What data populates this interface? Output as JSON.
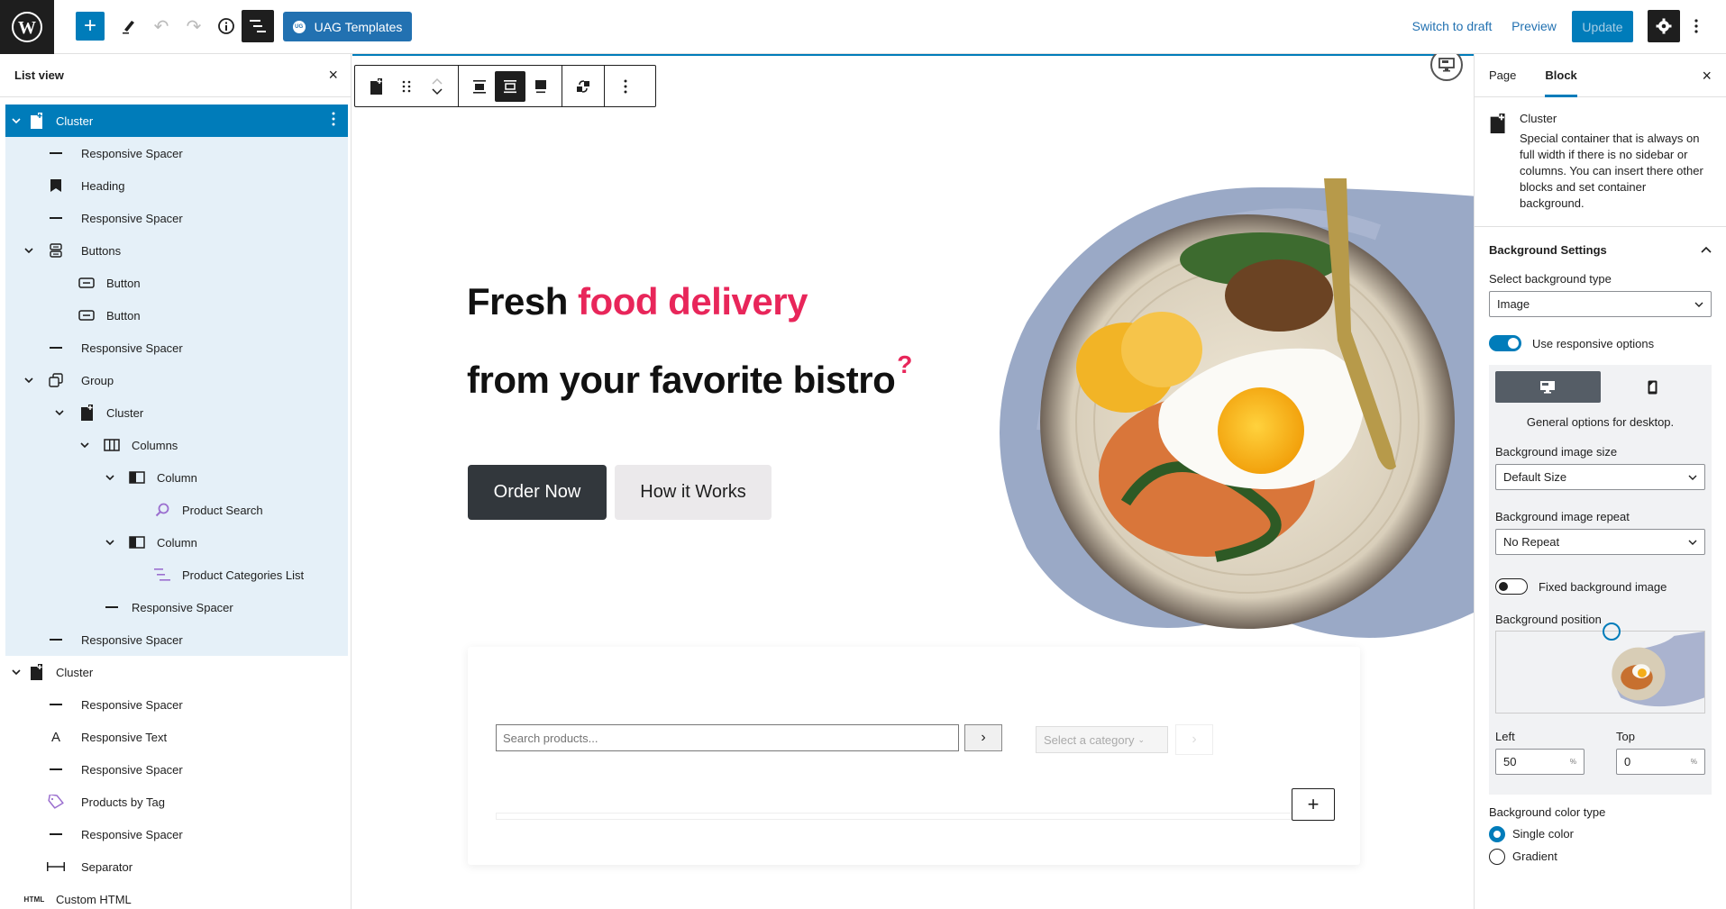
{
  "topbar": {
    "wp_logo": "wordpress-logo",
    "inserter_label": "+",
    "uag_badge": "UG",
    "uag_label": "UAG Templates",
    "switch_to_draft": "Switch to draft",
    "preview": "Preview",
    "update": "Update"
  },
  "listview": {
    "title": "List view",
    "close": "×",
    "items": [
      {
        "label": "Cluster",
        "icon": "cluster-icon",
        "depth": 0,
        "expanded": true,
        "selected": true
      },
      {
        "label": "Responsive Spacer",
        "icon": "spacer-icon",
        "depth": 1
      },
      {
        "label": "Heading",
        "icon": "heading-bookmark-icon",
        "depth": 1
      },
      {
        "label": "Responsive Spacer",
        "icon": "spacer-icon",
        "depth": 1
      },
      {
        "label": "Buttons",
        "icon": "buttons-icon",
        "depth": 1,
        "expanded": true
      },
      {
        "label": "Button",
        "icon": "button-icon",
        "depth": 2
      },
      {
        "label": "Button",
        "icon": "button-icon",
        "depth": 2
      },
      {
        "label": "Responsive Spacer",
        "icon": "spacer-icon",
        "depth": 1
      },
      {
        "label": "Group",
        "icon": "group-icon",
        "depth": 1,
        "expanded": true
      },
      {
        "label": "Cluster",
        "icon": "cluster-icon",
        "depth": 2,
        "expanded": true
      },
      {
        "label": "Columns",
        "icon": "columns-icon",
        "depth": 3,
        "expanded": true
      },
      {
        "label": "Column",
        "icon": "column-icon",
        "depth": 4,
        "expanded": true
      },
      {
        "label": "Product Search",
        "icon": "product-search-icon",
        "depth": 5
      },
      {
        "label": "Column",
        "icon": "column-icon",
        "depth": 4,
        "expanded": true
      },
      {
        "label": "Product Categories List",
        "icon": "product-categories-icon",
        "depth": 5
      },
      {
        "label": "Responsive Spacer",
        "icon": "spacer-icon",
        "depth": 3
      },
      {
        "label": "Responsive Spacer",
        "icon": "spacer-icon",
        "depth": 1
      },
      {
        "label": "Cluster",
        "icon": "cluster-icon",
        "depth": 0,
        "expanded": true
      },
      {
        "label": "Responsive Spacer",
        "icon": "spacer-icon",
        "depth": 1
      },
      {
        "label": "Responsive Text",
        "icon": "responsive-text-icon",
        "depth": 1
      },
      {
        "label": "Responsive Spacer",
        "icon": "spacer-icon",
        "depth": 1
      },
      {
        "label": "Products by Tag",
        "icon": "tag-icon",
        "depth": 1
      },
      {
        "label": "Responsive Spacer",
        "icon": "spacer-icon",
        "depth": 1
      },
      {
        "label": "Separator",
        "icon": "separator-icon",
        "depth": 1
      },
      {
        "label": "Custom HTML",
        "icon": "html-icon",
        "depth": 0
      }
    ]
  },
  "canvas": {
    "hero": {
      "line1_plain": "Fresh ",
      "line1_accent": "food delivery",
      "line2": "from your favorite bistro",
      "line2_mark": "?",
      "accent_color": "#e8265a"
    },
    "buttons": {
      "order_now": "Order Now",
      "how_it_works": "How it Works"
    },
    "search": {
      "placeholder": "Search products...",
      "go": "›"
    },
    "category": {
      "placeholder": "Select a category",
      "go": "›"
    },
    "add_block": "+"
  },
  "sidebar": {
    "tabs": {
      "page": "Page",
      "block": "Block"
    },
    "close": "×",
    "block_card": {
      "title": "Cluster",
      "description": "Special container that is always on full width if there is no sidebar or columns. You can insert there other blocks and set container background."
    },
    "background_settings": {
      "title": "Background Settings",
      "type_label": "Select background type",
      "type_value": "Image",
      "responsive_toggle_label": "Use responsive options",
      "responsive_toggle_on": true,
      "device_note": "General options for desktop.",
      "image_size_label": "Background image size",
      "image_size_value": "Default Size",
      "image_repeat_label": "Background image repeat",
      "image_repeat_value": "No Repeat",
      "fixed_label": "Fixed background image",
      "fixed_on": false,
      "position_label": "Background position",
      "left_label": "Left",
      "left_value": "50",
      "top_label": "Top",
      "top_value": "0",
      "unit": "%",
      "color_type_label": "Background color type",
      "color_options": [
        "Single color",
        "Gradient"
      ],
      "color_selected": "Single color"
    }
  },
  "colors": {
    "wp_blue": "#007cba",
    "uag_blue": "#2271b1",
    "list_selected_bg": "#e5f0f8",
    "dark": "#1e1e1e",
    "accent_pink": "#e8265a",
    "purple_icon": "#9b6fcf"
  }
}
